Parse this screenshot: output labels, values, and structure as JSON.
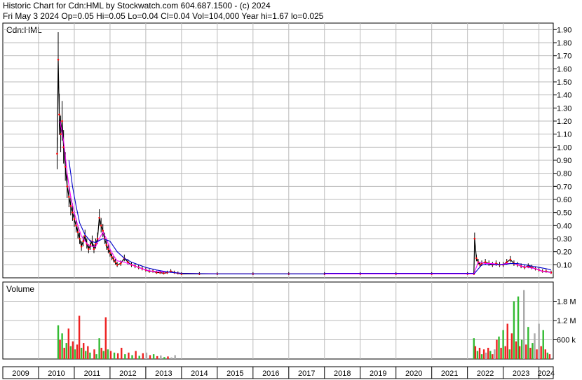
{
  "header": {
    "line1": "Historic Chart for Cdn:HML by Stockwatch.com 604.687.1500 - (c) 2024",
    "line2": "Fri May  3 2024   Op=0.05  Hi=0.05  Lo=0.04  Cl=0.04  Vol=104,000   Year hi=1.67   lo=0.025"
  },
  "colors": {
    "price_bar": "#000000",
    "ma_short": "#ff00ff",
    "ma_long": "#0000cc",
    "close_dot": "#ff0000",
    "vol_up": "#33bb33",
    "vol_down": "#ee2222",
    "vol_neutral": "#aaaaaa",
    "grid": "#bbbbbb"
  },
  "chart_data": [
    {
      "type": "line",
      "panel_label": "Cdn:HML",
      "y_ticks": [
        "1.90",
        "1.80",
        "1.70",
        "1.60",
        "1.50",
        "1.40",
        "1.30",
        "1.20",
        "1.10",
        "1.00",
        "0.90",
        "0.80",
        "0.70",
        "0.60",
        "0.50",
        "0.40",
        "0.30",
        "0.20",
        "0.10"
      ],
      "ylim": [
        0,
        1.95
      ],
      "x_years": [
        "2009",
        "2010",
        "2011",
        "2012",
        "2013",
        "2014",
        "2015",
        "2016",
        "2017",
        "2018",
        "2019",
        "2020",
        "2021",
        "2022",
        "2023",
        "2024"
      ],
      "xlim": [
        2009.0,
        2024.4
      ],
      "series": [
        {
          "role": "price",
          "x": [
            2010.52,
            2010.55,
            2010.58,
            2010.62,
            2010.66,
            2010.7,
            2010.75,
            2010.8,
            2010.85,
            2010.9,
            2010.95,
            2011.0,
            2011.05,
            2011.1,
            2011.15,
            2011.2,
            2011.25,
            2011.3,
            2011.35,
            2011.4,
            2011.45,
            2011.5,
            2011.55,
            2011.6,
            2011.65,
            2011.7,
            2011.75,
            2011.8,
            2011.85,
            2011.9,
            2011.95,
            2012.0,
            2012.05,
            2012.1,
            2012.15,
            2012.2,
            2012.3,
            2012.4,
            2012.5,
            2012.6,
            2012.7,
            2012.8,
            2012.9,
            2013.0,
            2013.1,
            2013.2,
            2013.3,
            2013.4,
            2013.5,
            2013.6,
            2013.7,
            2013.8,
            2013.9,
            2014.0,
            2014.5,
            2015.0,
            2016.0,
            2017.0,
            2018.0,
            2019.0,
            2020.0,
            2021.0,
            2022.0,
            2022.18,
            2022.2,
            2022.25,
            2022.3,
            2022.35,
            2022.4,
            2022.5,
            2022.6,
            2022.7,
            2022.8,
            2022.9,
            2023.0,
            2023.1,
            2023.2,
            2023.3,
            2023.4,
            2023.5,
            2023.6,
            2023.7,
            2023.8,
            2023.9,
            2024.0,
            2024.1,
            2024.2,
            2024.34
          ],
          "values": [
            0.95,
            1.67,
            1.25,
            1.1,
            1.2,
            1.0,
            0.85,
            0.7,
            0.62,
            0.55,
            0.5,
            0.45,
            0.4,
            0.35,
            0.3,
            0.24,
            0.28,
            0.32,
            0.26,
            0.22,
            0.25,
            0.28,
            0.22,
            0.26,
            0.3,
            0.46,
            0.4,
            0.36,
            0.3,
            0.25,
            0.22,
            0.19,
            0.16,
            0.14,
            0.12,
            0.1,
            0.11,
            0.15,
            0.12,
            0.1,
            0.09,
            0.08,
            0.07,
            0.06,
            0.05,
            0.05,
            0.04,
            0.04,
            0.035,
            0.04,
            0.05,
            0.04,
            0.035,
            0.03,
            0.03,
            0.03,
            0.03,
            0.03,
            0.03,
            0.03,
            0.03,
            0.03,
            0.03,
            0.03,
            0.3,
            0.15,
            0.12,
            0.1,
            0.11,
            0.12,
            0.11,
            0.1,
            0.11,
            0.1,
            0.1,
            0.12,
            0.14,
            0.11,
            0.1,
            0.09,
            0.08,
            0.09,
            0.08,
            0.07,
            0.06,
            0.05,
            0.05,
            0.04
          ]
        },
        {
          "role": "moving-average-short",
          "x": [
            2010.6,
            2010.7,
            2010.8,
            2010.9,
            2011.0,
            2011.1,
            2011.2,
            2011.3,
            2011.4,
            2011.5,
            2011.6,
            2011.7,
            2011.8,
            2011.9,
            2012.0,
            2012.1,
            2012.2,
            2012.4,
            2012.6,
            2012.8,
            2013.0,
            2013.2,
            2013.4,
            2013.6,
            2013.8,
            2014.0,
            2015.0,
            2017.0,
            2019.0,
            2021.0,
            2022.18,
            2022.3,
            2022.5,
            2022.7,
            2022.9,
            2023.1,
            2023.3,
            2023.5,
            2023.7,
            2023.9,
            2024.1,
            2024.34
          ],
          "values": [
            1.2,
            1.05,
            0.8,
            0.62,
            0.5,
            0.4,
            0.32,
            0.28,
            0.25,
            0.24,
            0.24,
            0.3,
            0.35,
            0.3,
            0.22,
            0.17,
            0.13,
            0.12,
            0.1,
            0.08,
            0.06,
            0.05,
            0.045,
            0.045,
            0.04,
            0.035,
            0.03,
            0.03,
            0.03,
            0.03,
            0.03,
            0.12,
            0.11,
            0.11,
            0.1,
            0.11,
            0.11,
            0.09,
            0.08,
            0.07,
            0.05,
            0.04
          ]
        },
        {
          "role": "moving-average-long",
          "x": [
            2010.85,
            2010.95,
            2011.05,
            2011.15,
            2011.3,
            2011.45,
            2011.6,
            2011.8,
            2012.0,
            2012.2,
            2012.4,
            2012.6,
            2012.8,
            2013.0,
            2013.3,
            2013.6,
            2014.0,
            2015.0,
            2016.0,
            2017.0,
            2018.0,
            2018.01,
            2019.0,
            2020.0,
            2021.0,
            2022.0,
            2022.2,
            2022.4,
            2022.6,
            2022.8,
            2023.0,
            2023.2,
            2023.4,
            2023.6,
            2023.8,
            2024.0,
            2024.2,
            2024.34
          ],
          "values": [
            0.9,
            0.7,
            0.55,
            0.42,
            0.33,
            0.28,
            0.27,
            0.3,
            0.28,
            0.2,
            0.15,
            0.12,
            0.1,
            0.08,
            0.06,
            0.045,
            0.035,
            0.03,
            0.03,
            0.03,
            0.03,
            0.035,
            0.035,
            0.035,
            0.035,
            0.035,
            0.035,
            0.1,
            0.1,
            0.1,
            0.1,
            0.11,
            0.11,
            0.1,
            0.09,
            0.08,
            0.07,
            0.06
          ]
        }
      ]
    },
    {
      "type": "bar",
      "panel_label": "Volume",
      "y_ticks": [
        "1.8 M",
        "1.2 M",
        "600 k"
      ],
      "y_tick_values": [
        1800000,
        1200000,
        600000
      ],
      "ylim": [
        0,
        2400000
      ],
      "xlim": [
        2009.0,
        2024.4
      ],
      "bars": [
        {
          "x": 2010.55,
          "v": 1050000,
          "c": "up"
        },
        {
          "x": 2010.6,
          "v": 600000,
          "c": "down"
        },
        {
          "x": 2010.66,
          "v": 800000,
          "c": "up"
        },
        {
          "x": 2010.72,
          "v": 350000,
          "c": "down"
        },
        {
          "x": 2010.78,
          "v": 500000,
          "c": "up"
        },
        {
          "x": 2010.84,
          "v": 950000,
          "c": "down"
        },
        {
          "x": 2010.9,
          "v": 400000,
          "c": "up"
        },
        {
          "x": 2010.96,
          "v": 550000,
          "c": "down"
        },
        {
          "x": 2011.02,
          "v": 300000,
          "c": "up"
        },
        {
          "x": 2011.08,
          "v": 450000,
          "c": "down"
        },
        {
          "x": 2011.14,
          "v": 1350000,
          "c": "down"
        },
        {
          "x": 2011.2,
          "v": 350000,
          "c": "up"
        },
        {
          "x": 2011.26,
          "v": 500000,
          "c": "down"
        },
        {
          "x": 2011.32,
          "v": 250000,
          "c": "up"
        },
        {
          "x": 2011.38,
          "v": 400000,
          "c": "down"
        },
        {
          "x": 2011.44,
          "v": 200000,
          "c": "up"
        },
        {
          "x": 2011.56,
          "v": 300000,
          "c": "down"
        },
        {
          "x": 2011.62,
          "v": 150000,
          "c": "up"
        },
        {
          "x": 2011.7,
          "v": 650000,
          "c": "up"
        },
        {
          "x": 2011.76,
          "v": 350000,
          "c": "down"
        },
        {
          "x": 2011.82,
          "v": 250000,
          "c": "up"
        },
        {
          "x": 2011.88,
          "v": 1300000,
          "c": "down"
        },
        {
          "x": 2011.94,
          "v": 300000,
          "c": "up"
        },
        {
          "x": 2012.02,
          "v": 250000,
          "c": "down"
        },
        {
          "x": 2012.12,
          "v": 200000,
          "c": "up"
        },
        {
          "x": 2012.22,
          "v": 180000,
          "c": "down"
        },
        {
          "x": 2012.32,
          "v": 350000,
          "c": "down"
        },
        {
          "x": 2012.42,
          "v": 150000,
          "c": "up"
        },
        {
          "x": 2012.52,
          "v": 200000,
          "c": "down"
        },
        {
          "x": 2012.62,
          "v": 120000,
          "c": "up"
        },
        {
          "x": 2012.72,
          "v": 250000,
          "c": "down"
        },
        {
          "x": 2012.82,
          "v": 100000,
          "c": "up"
        },
        {
          "x": 2012.92,
          "v": 180000,
          "c": "down"
        },
        {
          "x": 2013.02,
          "v": 200000,
          "c": "neutral"
        },
        {
          "x": 2013.12,
          "v": 120000,
          "c": "down"
        },
        {
          "x": 2013.22,
          "v": 150000,
          "c": "up"
        },
        {
          "x": 2013.32,
          "v": 90000,
          "c": "down"
        },
        {
          "x": 2013.42,
          "v": 110000,
          "c": "neutral"
        },
        {
          "x": 2013.52,
          "v": 60000,
          "c": "up"
        },
        {
          "x": 2013.62,
          "v": 80000,
          "c": "down"
        },
        {
          "x": 2013.72,
          "v": 50000,
          "c": "neutral"
        },
        {
          "x": 2013.82,
          "v": 120000,
          "c": "neutral"
        },
        {
          "x": 2022.18,
          "v": 650000,
          "c": "up"
        },
        {
          "x": 2022.22,
          "v": 400000,
          "c": "down"
        },
        {
          "x": 2022.28,
          "v": 250000,
          "c": "up"
        },
        {
          "x": 2022.34,
          "v": 350000,
          "c": "down"
        },
        {
          "x": 2022.4,
          "v": 150000,
          "c": "up"
        },
        {
          "x": 2022.46,
          "v": 300000,
          "c": "down"
        },
        {
          "x": 2022.52,
          "v": 200000,
          "c": "neutral"
        },
        {
          "x": 2022.58,
          "v": 350000,
          "c": "down"
        },
        {
          "x": 2022.64,
          "v": 250000,
          "c": "up"
        },
        {
          "x": 2022.7,
          "v": 150000,
          "c": "down"
        },
        {
          "x": 2022.76,
          "v": 300000,
          "c": "neutral"
        },
        {
          "x": 2022.82,
          "v": 600000,
          "c": "down"
        },
        {
          "x": 2022.88,
          "v": 700000,
          "c": "up"
        },
        {
          "x": 2022.94,
          "v": 350000,
          "c": "down"
        },
        {
          "x": 2023.0,
          "v": 900000,
          "c": "up"
        },
        {
          "x": 2023.06,
          "v": 400000,
          "c": "down"
        },
        {
          "x": 2023.12,
          "v": 1100000,
          "c": "down"
        },
        {
          "x": 2023.18,
          "v": 300000,
          "c": "up"
        },
        {
          "x": 2023.24,
          "v": 800000,
          "c": "down"
        },
        {
          "x": 2023.3,
          "v": 1800000,
          "c": "up"
        },
        {
          "x": 2023.36,
          "v": 550000,
          "c": "down"
        },
        {
          "x": 2023.42,
          "v": 1950000,
          "c": "up"
        },
        {
          "x": 2023.46,
          "v": 400000,
          "c": "down"
        },
        {
          "x": 2023.52,
          "v": 600000,
          "c": "up"
        },
        {
          "x": 2023.58,
          "v": 2150000,
          "c": "neutral"
        },
        {
          "x": 2023.64,
          "v": 450000,
          "c": "down"
        },
        {
          "x": 2023.7,
          "v": 1000000,
          "c": "up"
        },
        {
          "x": 2023.76,
          "v": 350000,
          "c": "down"
        },
        {
          "x": 2023.82,
          "v": 500000,
          "c": "up"
        },
        {
          "x": 2023.88,
          "v": 800000,
          "c": "neutral"
        },
        {
          "x": 2023.94,
          "v": 300000,
          "c": "down"
        },
        {
          "x": 2024.0,
          "v": 1100000,
          "c": "neutral"
        },
        {
          "x": 2024.06,
          "v": 400000,
          "c": "down"
        },
        {
          "x": 2024.12,
          "v": 900000,
          "c": "up"
        },
        {
          "x": 2024.18,
          "v": 300000,
          "c": "down"
        },
        {
          "x": 2024.24,
          "v": 200000,
          "c": "up"
        },
        {
          "x": 2024.3,
          "v": 150000,
          "c": "down"
        }
      ]
    }
  ]
}
